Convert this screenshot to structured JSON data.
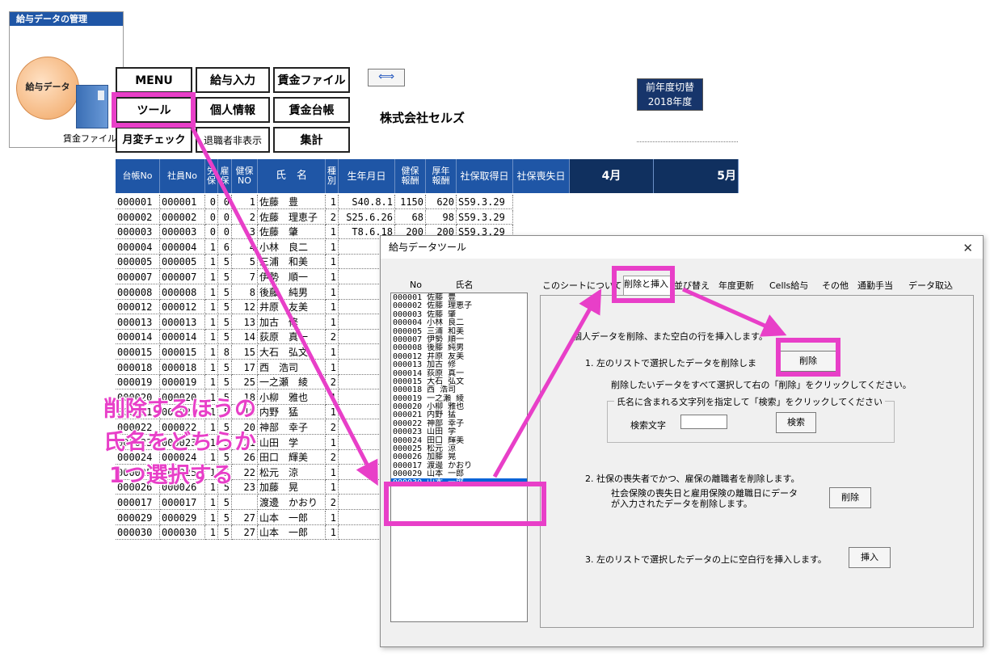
{
  "launcher": {
    "title": "給与データの管理",
    "circle_label": "給与データ",
    "book_label": "賃金ファイル"
  },
  "menu": {
    "menu": "MENU",
    "kyuyo_input": "給与入力",
    "chingin_file": "賃金ファイル",
    "tool": "ツール",
    "kojin_joho": "個人情報",
    "chingin_daicho": "賃金台帳",
    "getsuhen_check": "月変チェック",
    "taishokusha_hihyoji": "退職者非表示",
    "shukei": "集計"
  },
  "company": {
    "name": "株式会社セルズ",
    "year_switch_line1": "前年度切替",
    "year_switch_line2": "2018年度",
    "arrow_icon": "resize-arrows-icon"
  },
  "table": {
    "headers": [
      "台帳No",
      "社員No",
      "労\n保",
      "雇\n保",
      "健保\nNO",
      "氏　名",
      "種\n別",
      "生年月日",
      "健保\n報酬",
      "厚年\n報酬",
      "社保取得日",
      "社保喪失日",
      "4月",
      "5月"
    ],
    "rows": [
      [
        "000001",
        "000001",
        "0",
        "0",
        "1",
        "佐藤　豊",
        "1",
        "S40.8.1",
        "1150",
        "620",
        "S59.3.29"
      ],
      [
        "000002",
        "000002",
        "0",
        "0",
        "2",
        "佐藤　理恵子",
        "2",
        "S25.6.26",
        "68",
        "98",
        "S59.3.29"
      ],
      [
        "000003",
        "000003",
        "0",
        "0",
        "3",
        "佐藤　肇",
        "1",
        "T8.6.18",
        "200",
        "200",
        "S59.3.29"
      ],
      [
        "000004",
        "000004",
        "1",
        "6",
        "4",
        "小林　良二",
        "1",
        "",
        "",
        "",
        ""
      ],
      [
        "000005",
        "000005",
        "1",
        "5",
        "5",
        "三浦　和美",
        "1",
        "",
        "",
        "",
        ""
      ],
      [
        "000007",
        "000007",
        "1",
        "5",
        "7",
        "伊勢　順一",
        "1",
        "",
        "",
        "",
        ""
      ],
      [
        "000008",
        "000008",
        "1",
        "5",
        "8",
        "後藤　純男",
        "1",
        "",
        "",
        "",
        ""
      ],
      [
        "000012",
        "000012",
        "1",
        "5",
        "12",
        "井原　友美",
        "1",
        "",
        "",
        "",
        ""
      ],
      [
        "000013",
        "000013",
        "1",
        "5",
        "13",
        "加古　修",
        "1",
        "",
        "",
        "",
        ""
      ],
      [
        "000014",
        "000014",
        "1",
        "5",
        "14",
        "荻原　真一",
        "2",
        "",
        "",
        "",
        ""
      ],
      [
        "000015",
        "000015",
        "1",
        "8",
        "15",
        "大石　弘文",
        "1",
        "",
        "",
        "",
        ""
      ],
      [
        "000018",
        "000018",
        "1",
        "5",
        "17",
        "西　浩司",
        "1",
        "",
        "",
        "",
        ""
      ],
      [
        "000019",
        "000019",
        "1",
        "5",
        "25",
        "一之瀬　綾",
        "2",
        "",
        "",
        "",
        ""
      ],
      [
        "000020",
        "000020",
        "1",
        "5",
        "18",
        "小柳　雅也",
        "1",
        "",
        "",
        "",
        ""
      ],
      [
        "000021",
        "000021",
        "1",
        "5",
        "19",
        "内野　猛",
        "1",
        "",
        "",
        "",
        ""
      ],
      [
        "000022",
        "000022",
        "1",
        "5",
        "20",
        "神部　幸子",
        "2",
        "",
        "",
        "",
        ""
      ],
      [
        "000023",
        "000023",
        "1",
        "5",
        "21",
        "山田　学",
        "1",
        "",
        "",
        "",
        ""
      ],
      [
        "000024",
        "000024",
        "1",
        "5",
        "26",
        "田口　輝美",
        "2",
        "",
        "",
        "",
        ""
      ],
      [
        "000025",
        "000025",
        "1",
        "5",
        "22",
        "松元　涼",
        "1",
        "",
        "",
        "",
        ""
      ],
      [
        "000026",
        "000026",
        "1",
        "5",
        "23",
        "加藤　晃",
        "1",
        "",
        "",
        "",
        ""
      ],
      [
        "000017",
        "000017",
        "1",
        "5",
        "",
        "渡邊　かおり",
        "2",
        "",
        "",
        "",
        ""
      ],
      [
        "000029",
        "000029",
        "1",
        "5",
        "27",
        "山本　一郎",
        "1",
        "",
        "",
        "",
        ""
      ],
      [
        "000030",
        "000030",
        "1",
        "5",
        "27",
        "山本　一郎",
        "1",
        "",
        "",
        "",
        ""
      ]
    ]
  },
  "annotation": {
    "line1": "削除するほうの",
    "line2": "氏名をどちらか",
    "line3": "1つ選択する",
    "color": "#e83fc8"
  },
  "dialog": {
    "title": "給与データツール",
    "close": "✕",
    "list_header_no": "No",
    "list_header_name": "氏名",
    "list_items": [
      "000001 佐藤 豊",
      "000002 佐藤 理恵子",
      "000003 佐藤 肇",
      "000004 小林 良二",
      "000005 三浦 和美",
      "000007 伊勢 順一",
      "000008 後藤 純男",
      "000012 井原 友美",
      "000013 加古 修",
      "000014 荻原 真一",
      "000015 大石 弘文",
      "000018 西 浩司",
      "000019 一之瀬 綾",
      "000020 小柳 雅也",
      "000021 内野 猛",
      "000022 神部 幸子",
      "000023 山田 学",
      "000024 田口 輝美",
      "000025 松元 涼",
      "000026 加藤 晃",
      "000017 渡邊 かおり",
      "000029 山本 一郎",
      "000030 山本 一郎"
    ],
    "selected_index": 22,
    "tabs": [
      "このシートについて",
      "削除と挿入",
      "並び替え",
      "年度更新",
      "Cells給与",
      "その他",
      "通勤手当",
      "データ取込"
    ],
    "active_tab": 1,
    "intro": "個人データを削除、また空白の行を挿入します。",
    "sec1_title": "1.  左のリストで選択したデータを削除しま",
    "sec1_btn": "削除",
    "sec1_desc": "削除したいデータをすべて選択して右の「削除」をクリックしてください。",
    "group_label": "氏名に含まれる文字列を指定して「検索」をクリックしてください",
    "search_label": "検索文字",
    "search_value": "",
    "search_btn": "検索",
    "sec2_title": "2.  社保の喪失者でかつ、雇保の離職者を削除します。",
    "sec2_desc1": "社会保険の喪失日と雇用保険の離職日にデータ",
    "sec2_desc2": "が入力されたデータを削除します。",
    "sec2_btn": "削除",
    "sec3_title": "3.  左のリストで選択したデータの上に空白行を挿入します。",
    "sec3_btn": "挿入"
  }
}
